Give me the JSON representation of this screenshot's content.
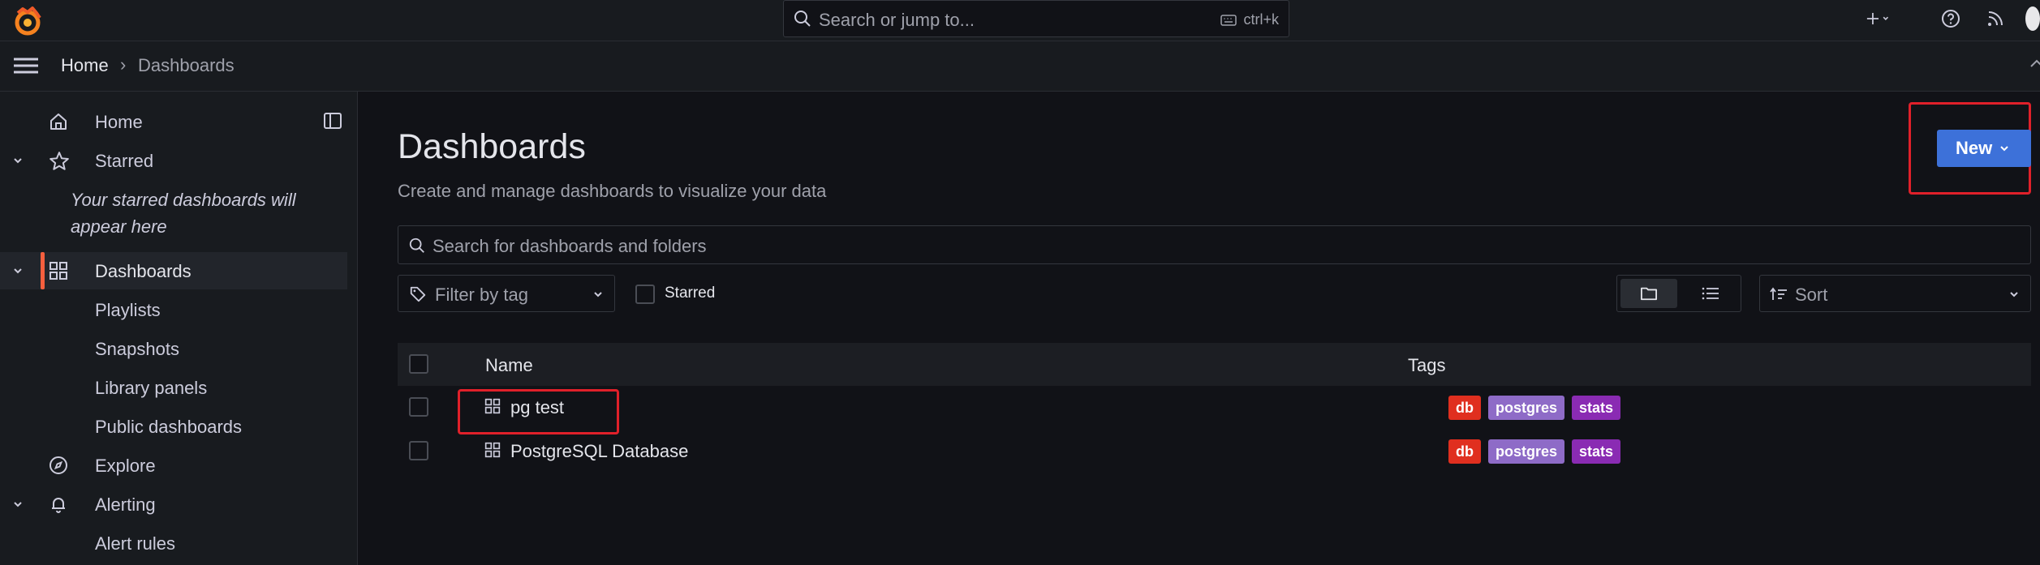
{
  "topbar": {
    "search_placeholder": "Search or jump to...",
    "shortcut": "ctrl+k",
    "add_icon": "plus-icon",
    "help_icon": "help-icon",
    "news_icon": "rss-icon"
  },
  "breadcrumb": {
    "home": "Home",
    "separator": "›",
    "current": "Dashboards"
  },
  "sidebar": {
    "home": "Home",
    "starred": "Starred",
    "starred_empty": "Your starred dashboards will appear here",
    "dashboards": "Dashboards",
    "playlists": "Playlists",
    "snapshots": "Snapshots",
    "library_panels": "Library panels",
    "public_dashboards": "Public dashboards",
    "explore": "Explore",
    "alerting": "Alerting",
    "alert_rules": "Alert rules"
  },
  "main": {
    "title": "Dashboards",
    "subtitle": "Create and manage dashboards to visualize your data",
    "new_label": "New",
    "search_placeholder": "Search for dashboards and folders",
    "tag_filter_placeholder": "Filter by tag",
    "starred_label": "Starred",
    "sort_placeholder": "Sort",
    "columns": {
      "name": "Name",
      "tags": "Tags"
    },
    "rows": [
      {
        "name": "pg test",
        "tags": [
          "db",
          "postgres",
          "stats"
        ]
      },
      {
        "name": "PostgreSQL Database",
        "tags": [
          "db",
          "postgres",
          "stats"
        ]
      }
    ]
  },
  "colors": {
    "accent": "#3d71d9",
    "active_bar": "#f55f3e",
    "tag_db": "#e02f1f",
    "tag_postgres": "#8e6bc7",
    "tag_stats": "#8a2bb3",
    "highlight": "#e0202a"
  }
}
